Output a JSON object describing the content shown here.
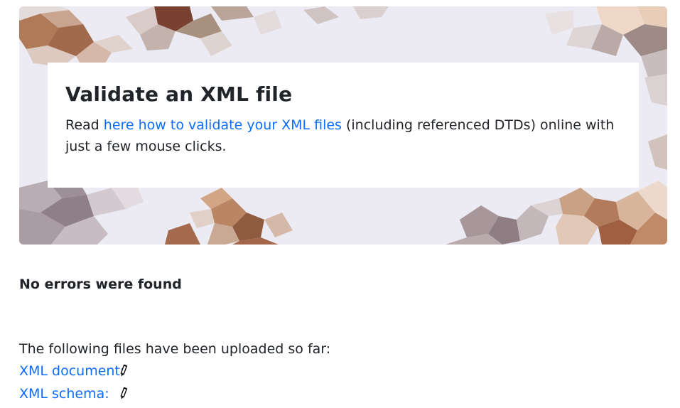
{
  "hero": {
    "title": "Validate an XML file",
    "text_before": "Read ",
    "link_text": "here how to validate your XML files",
    "text_after": " (including referenced DTDs) online with just a few mouse clicks."
  },
  "result": {
    "message": "No errors were found"
  },
  "uploads": {
    "intro": "The following files have been uploaded so far:",
    "items": [
      {
        "label": "XML document:",
        "icon": "pencil-icon"
      },
      {
        "label": "XML schema:",
        "icon": "pencil-icon"
      }
    ]
  },
  "colors": {
    "link": "#0d6efd",
    "text": "#212529",
    "hero_background": "#eeeef3"
  }
}
